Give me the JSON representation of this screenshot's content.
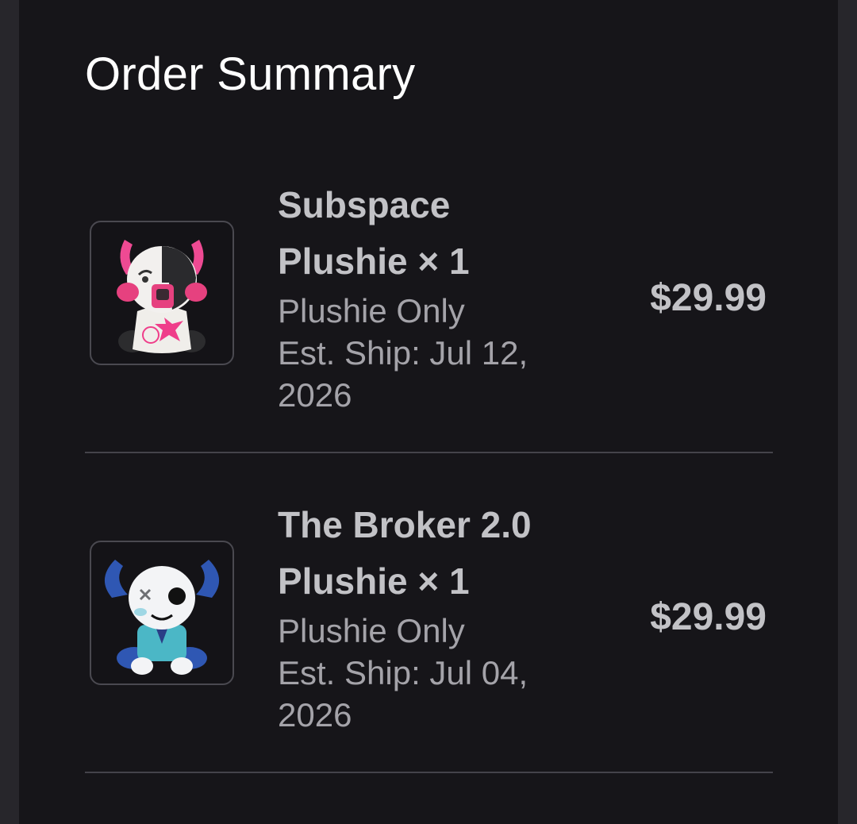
{
  "page": {
    "title": "Order Summary"
  },
  "items": [
    {
      "name_line1": "Subspace",
      "name_line2": "Plushie × 1",
      "variant": "Plushie Only",
      "ship_line1": "Est. Ship: Jul 12,",
      "ship_line2": "2026",
      "price": "$29.99",
      "thumbnail_icon": "subspace-plushie-image"
    },
    {
      "name_line1": "The Broker 2.0",
      "name_line2": "Plushie × 1",
      "variant": "Plushie Only",
      "ship_line1": "Est. Ship: Jul 04,",
      "ship_line2": "2026",
      "price": "$29.99",
      "thumbnail_icon": "broker-plushie-image"
    }
  ],
  "colors": {
    "background": "#27262b",
    "panel": "#161519",
    "title_text": "#ffffff",
    "item_text": "#c2c2c6",
    "meta_text": "#a4a3a9",
    "divider": "#44434a"
  }
}
